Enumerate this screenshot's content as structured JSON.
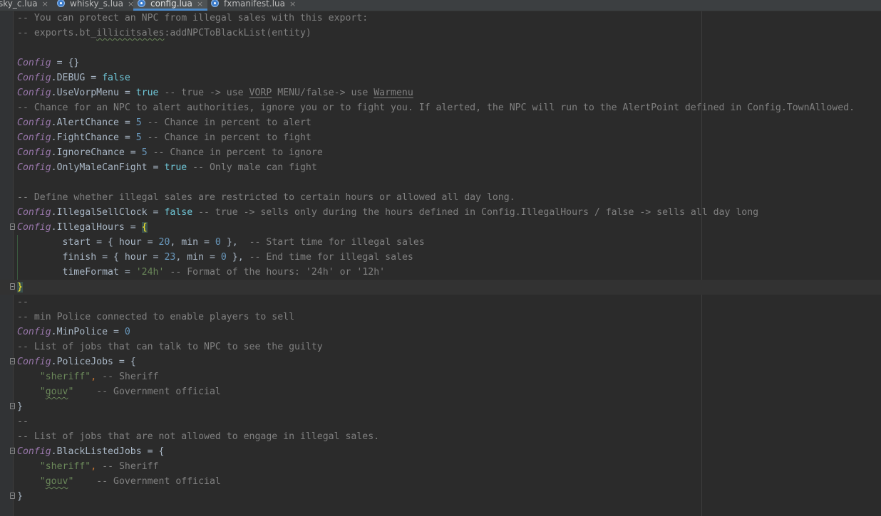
{
  "tabs": [
    {
      "label": "sky_c.lua",
      "active": false,
      "icon": "lua-file-icon"
    },
    {
      "label": "whisky_s.lua",
      "active": false,
      "icon": "lua-file-icon"
    },
    {
      "label": "config.lua",
      "active": true,
      "icon": "lua-file-icon"
    },
    {
      "label": "fxmanifest.lua",
      "active": false,
      "icon": "lua-file-icon"
    }
  ],
  "close_glyph": "×",
  "colors": {
    "background": "#2b2b2b",
    "comment": "#808080",
    "config": "#9876aa",
    "boolean": "#6fc7d8",
    "number": "#6897bb",
    "string": "#6a8759",
    "default": "#a9b7c6"
  },
  "lines": [
    [
      [
        "com",
        "-- You can protect an NPC from illegal sales with this export:"
      ]
    ],
    [
      [
        "com",
        "-- exports.bt_"
      ],
      [
        "com-squig",
        "illicitsales"
      ],
      [
        "com",
        ":addNPCToBlackList(entity)"
      ]
    ],
    [],
    [
      [
        "cfg",
        "Config"
      ],
      [
        "pl",
        " = {}"
      ]
    ],
    [
      [
        "cfg",
        "Config"
      ],
      [
        "pl",
        ".DEBUG = "
      ],
      [
        "bool",
        "false"
      ]
    ],
    [
      [
        "cfg",
        "Config"
      ],
      [
        "pl",
        ".UseVorpMenu = "
      ],
      [
        "bool",
        "true"
      ],
      [
        "com",
        " -- true -> use "
      ],
      [
        "com-ul",
        "VORP"
      ],
      [
        "com",
        " MENU/false-> use "
      ],
      [
        "com-ul",
        "Warmenu"
      ]
    ],
    [
      [
        "com",
        "-- Chance for an NPC to alert authorities, ignore you or to fight you. If alerted, the NPC will run to the AlertPoint defined in Config.TownAllowed."
      ]
    ],
    [
      [
        "cfg",
        "Config"
      ],
      [
        "pl",
        ".AlertChance = "
      ],
      [
        "num",
        "5"
      ],
      [
        "com",
        " -- Chance in percent to alert"
      ]
    ],
    [
      [
        "cfg",
        "Config"
      ],
      [
        "pl",
        ".FightChance = "
      ],
      [
        "num",
        "5"
      ],
      [
        "com",
        " -- Chance in percent to fight"
      ]
    ],
    [
      [
        "cfg",
        "Config"
      ],
      [
        "pl",
        ".IgnoreChance = "
      ],
      [
        "num",
        "5"
      ],
      [
        "com",
        " -- Chance in percent to ignore"
      ]
    ],
    [
      [
        "cfg",
        "Config"
      ],
      [
        "pl",
        ".OnlyMaleCanFight = "
      ],
      [
        "bool",
        "true"
      ],
      [
        "com",
        " -- Only male can fight"
      ]
    ],
    [],
    [
      [
        "com",
        "-- Define whether illegal sales are restricted to certain hours or allowed all day long."
      ]
    ],
    [
      [
        "cfg",
        "Config"
      ],
      [
        "pl",
        ".IllegalSellClock = "
      ],
      [
        "bool",
        "false"
      ],
      [
        "com",
        " -- true -> sells only during the hours defined in Config.IllegalHours / false -> sells all day long"
      ]
    ],
    [
      [
        "cfg",
        "Config"
      ],
      [
        "pl",
        ".IllegalHours = "
      ],
      [
        "brace",
        "{"
      ]
    ],
    [
      [
        "pl",
        "        start = { hour = "
      ],
      [
        "num",
        "20"
      ],
      [
        "pl",
        ", min = "
      ],
      [
        "num",
        "0"
      ],
      [
        "pl",
        " },  "
      ],
      [
        "com",
        "-- Start time for illegal sales"
      ]
    ],
    [
      [
        "pl",
        "        finish = { hour = "
      ],
      [
        "num",
        "23"
      ],
      [
        "pl",
        ", min = "
      ],
      [
        "num",
        "0"
      ],
      [
        "pl",
        " }, "
      ],
      [
        "com",
        "-- End time for illegal sales"
      ]
    ],
    [
      [
        "pl",
        "        timeFormat = "
      ],
      [
        "str",
        "'24h'"
      ],
      [
        "com",
        " -- Format of the hours: '24h' or '12h'"
      ]
    ],
    [
      [
        "brace",
        "}"
      ]
    ],
    [
      [
        "com",
        "--"
      ]
    ],
    [
      [
        "com",
        "-- min Police connected to enable players to sell"
      ]
    ],
    [
      [
        "cfg",
        "Config"
      ],
      [
        "pl",
        ".MinPolice = "
      ],
      [
        "num",
        "0"
      ]
    ],
    [
      [
        "com",
        "-- List of jobs that can talk to NPC to see the guilty"
      ]
    ],
    [
      [
        "cfg",
        "Config"
      ],
      [
        "pl",
        ".PoliceJobs = {"
      ]
    ],
    [
      [
        "pl",
        "    "
      ],
      [
        "str",
        "\"sheriff\""
      ],
      [
        "kw",
        ","
      ],
      [
        "com",
        " -- Sheriff"
      ]
    ],
    [
      [
        "pl",
        "    "
      ],
      [
        "str",
        "\""
      ],
      [
        "str-squig",
        "gouv"
      ],
      [
        "str",
        "\""
      ],
      [
        "com",
        "    -- Government official"
      ]
    ],
    [
      [
        "pl",
        "}"
      ]
    ],
    [
      [
        "com",
        "--"
      ]
    ],
    [
      [
        "com",
        "-- List of jobs that are not allowed to engage in illegal sales."
      ]
    ],
    [
      [
        "cfg",
        "Config"
      ],
      [
        "pl",
        ".BlackListedJobs = {"
      ]
    ],
    [
      [
        "pl",
        "    "
      ],
      [
        "str",
        "\"sheriff\""
      ],
      [
        "kw",
        ","
      ],
      [
        "com",
        " -- Sheriff"
      ]
    ],
    [
      [
        "pl",
        "    "
      ],
      [
        "str",
        "\""
      ],
      [
        "str-squig",
        "gouv"
      ],
      [
        "str",
        "\""
      ],
      [
        "com",
        "    -- Government official"
      ]
    ],
    [
      [
        "pl",
        "}"
      ]
    ]
  ]
}
